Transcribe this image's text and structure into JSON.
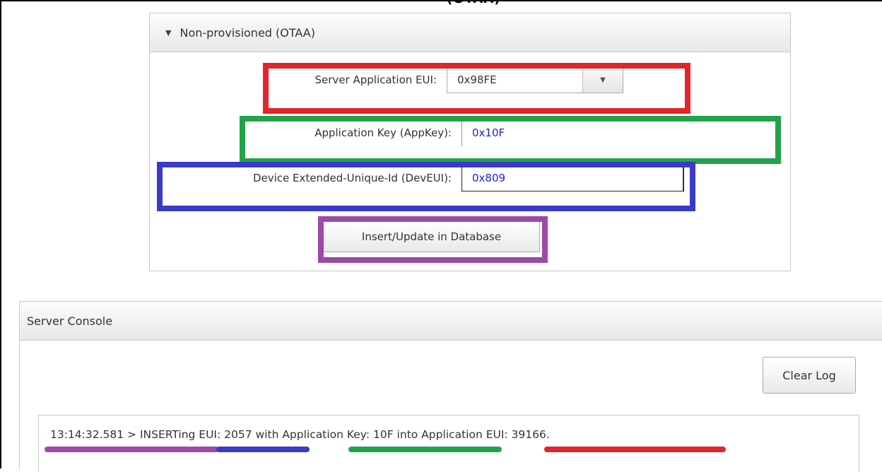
{
  "top_title_fragment": "(OTAA)",
  "otaa_panel": {
    "header_label": "Non-provisioned (OTAA)",
    "caret_icon": "▼",
    "fields": {
      "server_app_eui": {
        "label": "Server Application EUI:",
        "value": "0x98FE"
      },
      "app_key": {
        "label": "Application Key (AppKey):",
        "value": "0x10F"
      },
      "dev_eui": {
        "label": "Device Extended-Unique-Id (DevEUI):",
        "value": "0x809"
      }
    },
    "dropdown_icon": "▼",
    "insert_button": "Insert/Update in Database"
  },
  "console": {
    "header_label": "Server Console",
    "clear_button": "Clear Log",
    "log_line": "13:14:32.581 > INSERTing EUI: 2057 with Application Key: 10F into Application EUI: 39166."
  },
  "highlight_colors": {
    "red": "#e3242b",
    "green": "#24a24a",
    "blue": "#3a3ac8",
    "purple": "#9c4aa8"
  }
}
